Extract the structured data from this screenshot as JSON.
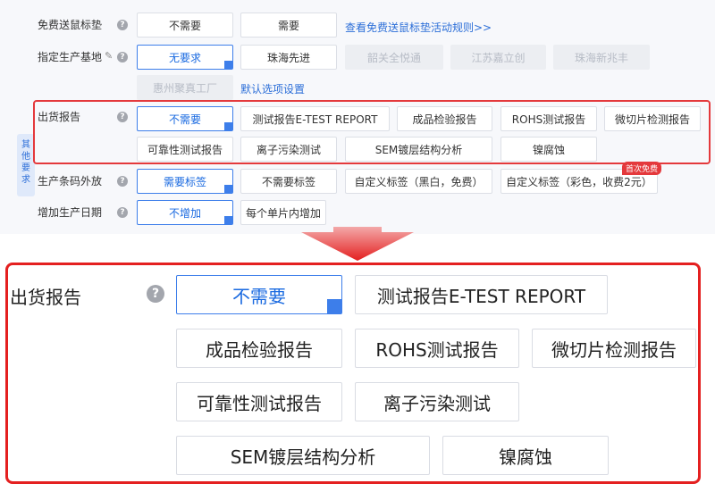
{
  "sections": {
    "free_mousepad": {
      "label": "免费送鼠标垫",
      "options": [
        {
          "label": "不需要",
          "state": "normal"
        },
        {
          "label": "需要",
          "state": "normal"
        }
      ],
      "link": "查看免费送鼠标垫活动规则>>"
    },
    "production_base": {
      "label": "指定生产基地",
      "options": [
        {
          "label": "无要求",
          "state": "selected"
        },
        {
          "label": "珠海先进",
          "state": "normal"
        },
        {
          "label": "韶关全悦通",
          "state": "disabled"
        },
        {
          "label": "江苏嘉立创",
          "state": "disabled"
        },
        {
          "label": "珠海新兆丰",
          "state": "disabled"
        },
        {
          "label": "惠州聚真工厂",
          "state": "disabled"
        }
      ],
      "link": "默认选项设置"
    },
    "shipping_report": {
      "label": "出货报告",
      "options": [
        {
          "label": "不需要",
          "state": "selected"
        },
        {
          "label": "测试报告E-TEST REPORT",
          "state": "normal"
        },
        {
          "label": "成品检验报告",
          "state": "normal"
        },
        {
          "label": "ROHS测试报告",
          "state": "normal"
        },
        {
          "label": "微切片检测报告",
          "state": "normal"
        },
        {
          "label": "可靠性测试报告",
          "state": "normal"
        },
        {
          "label": "离子污染测试",
          "state": "normal"
        },
        {
          "label": "SEM镀层结构分析",
          "state": "normal"
        },
        {
          "label": "镍腐蚀",
          "state": "normal"
        }
      ]
    },
    "barcode": {
      "label": "生产条码外放",
      "options": [
        {
          "label": "需要标签",
          "state": "selected"
        },
        {
          "label": "不需要标签",
          "state": "normal"
        },
        {
          "label": "自定义标签（黑白，免费）",
          "state": "normal"
        },
        {
          "label": "自定义标签（彩色，收费2元）",
          "state": "normal"
        }
      ],
      "badge": "首次免费"
    },
    "production_date": {
      "label": "增加生产日期",
      "options": [
        {
          "label": "不增加",
          "state": "selected"
        },
        {
          "label": "每个单片内增加",
          "state": "normal"
        }
      ]
    }
  },
  "side_tab": "其他要求",
  "colors": {
    "accent": "#3d7eea",
    "highlight_red": "#e42020",
    "disabled_bg": "#eceef2"
  },
  "icons": {
    "help": "question-circle-icon",
    "edit": "pencil-icon",
    "check": "check-corner-icon",
    "arrow": "down-arrow-icon"
  }
}
